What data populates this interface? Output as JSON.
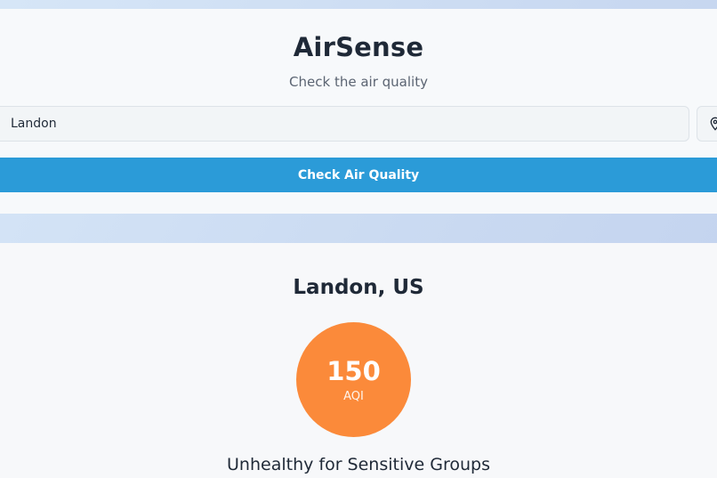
{
  "app": {
    "title": "AirSense",
    "subtitle": "Check the air quality"
  },
  "search": {
    "value": "Landon",
    "location_icon": "map-pin-icon",
    "button_label": "Check Air Quality"
  },
  "result": {
    "location": "Landon, US",
    "aqi_value": "150",
    "aqi_label": "AQI",
    "category": "Unhealthy for Sensitive Groups"
  },
  "colors": {
    "accent_button": "#2b9bd8",
    "aqi_circle": "#fb8a3a",
    "background_gradient": "#c9d9f1"
  }
}
